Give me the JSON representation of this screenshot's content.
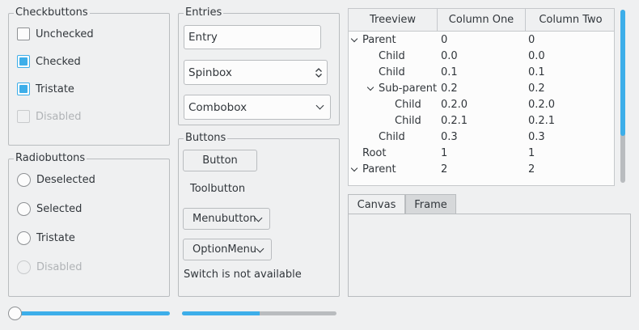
{
  "checkbuttons": {
    "title": "Checkbuttons",
    "items": [
      {
        "label": "Unchecked",
        "state": "unchecked"
      },
      {
        "label": "Checked",
        "state": "checked"
      },
      {
        "label": "Tristate",
        "state": "tristate"
      },
      {
        "label": "Disabled",
        "state": "disabled"
      }
    ]
  },
  "radiobuttons": {
    "title": "Radiobuttons",
    "items": [
      {
        "label": "Deselected",
        "state": "deselected"
      },
      {
        "label": "Selected",
        "state": "selected"
      },
      {
        "label": "Tristate",
        "state": "tristate"
      },
      {
        "label": "Disabled",
        "state": "disabled"
      }
    ]
  },
  "entries": {
    "title": "Entries",
    "entry_value": "Entry",
    "spinbox_value": "Spinbox",
    "combobox_value": "Combobox"
  },
  "buttons": {
    "title": "Buttons",
    "button_label": "Button",
    "toolbutton_label": "Toolbutton",
    "menubutton_label": "Menubutton",
    "optionmenu_label": "OptionMenu",
    "switch_text": "Switch is not available"
  },
  "treeview": {
    "headers": [
      "Treeview",
      "Column One",
      "Column Two"
    ],
    "rows": [
      {
        "name": "Parent",
        "c1": "0",
        "c2": "0",
        "depth": 0,
        "expanded": true
      },
      {
        "name": "Child",
        "c1": "0.0",
        "c2": "0.0",
        "depth": 1,
        "expanded": null
      },
      {
        "name": "Child",
        "c1": "0.1",
        "c2": "0.1",
        "depth": 1,
        "expanded": null
      },
      {
        "name": "Sub-parent",
        "c1": "0.2",
        "c2": "0.2",
        "depth": 1,
        "expanded": true
      },
      {
        "name": "Child",
        "c1": "0.2.0",
        "c2": "0.2.0",
        "depth": 2,
        "expanded": null
      },
      {
        "name": "Child",
        "c1": "0.2.1",
        "c2": "0.2.1",
        "depth": 2,
        "expanded": null
      },
      {
        "name": "Child",
        "c1": "0.3",
        "c2": "0.3",
        "depth": 1,
        "expanded": null
      },
      {
        "name": "Root",
        "c1": "1",
        "c2": "1",
        "depth": 0,
        "expanded": null
      },
      {
        "name": "Parent",
        "c1": "2",
        "c2": "2",
        "depth": 0,
        "expanded": true
      }
    ]
  },
  "notebook": {
    "tabs": [
      "Canvas",
      "Frame"
    ],
    "selected_tab": "Frame"
  },
  "scale": {
    "value_fraction": 0.0
  },
  "progress": {
    "value_fraction": 0.5
  },
  "colors": {
    "accent": "#3daee9",
    "background": "#eff0f1",
    "trough": "#b9bcbf"
  }
}
